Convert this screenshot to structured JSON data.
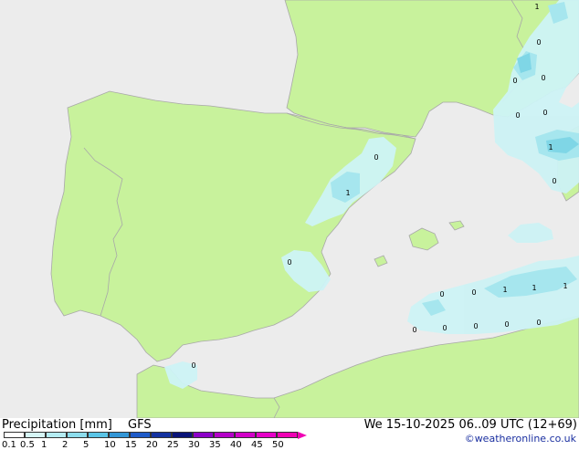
{
  "colors": {
    "sea": "#ececec",
    "land": "#c8f29c",
    "border": "#a8a8a8",
    "precip_light": "#cdf3f5",
    "precip_medium": "#a6e6ee",
    "precip_strong": "#7fd6e6"
  },
  "precip_labels": [
    {
      "id": "ib-0a",
      "text": "0"
    },
    {
      "id": "ib-1",
      "text": "1"
    },
    {
      "id": "ib-0b",
      "text": "0"
    },
    {
      "id": "ib-0c",
      "text": "0"
    },
    {
      "id": "fr-1",
      "text": "1"
    },
    {
      "id": "fr-0a",
      "text": "0"
    },
    {
      "id": "fr-0b",
      "text": "0"
    },
    {
      "id": "fr-0c",
      "text": "0"
    },
    {
      "id": "fr-0d",
      "text": "0"
    },
    {
      "id": "fr-0e",
      "text": "0"
    },
    {
      "id": "it-1",
      "text": "1"
    },
    {
      "id": "it-0a",
      "text": "0"
    },
    {
      "id": "med-0a",
      "text": "0"
    },
    {
      "id": "med-0b",
      "text": "0"
    },
    {
      "id": "med-1a",
      "text": "1"
    },
    {
      "id": "med-1b",
      "text": "1"
    },
    {
      "id": "med-1c",
      "text": "1"
    },
    {
      "id": "med-0c",
      "text": "0"
    },
    {
      "id": "med-0d",
      "text": "0"
    },
    {
      "id": "med-0e",
      "text": "0"
    },
    {
      "id": "med-0f",
      "text": "0"
    },
    {
      "id": "med-0g",
      "text": "0"
    }
  ],
  "footer": {
    "title": "Precipitation [mm]",
    "model": "GFS",
    "datetime": "We 15-10-2025 06..09 UTC (12+69)",
    "credit": "©weatheronline.co.uk"
  },
  "legend": {
    "ticks": [
      "0.1",
      "0.5",
      "1",
      "2",
      "5",
      "10",
      "15",
      "20",
      "25",
      "30",
      "35",
      "40",
      "45",
      "50"
    ],
    "colors": [
      "#ffffff",
      "#d6f6f6",
      "#b4ecf2",
      "#8cdcec",
      "#5ac4e6",
      "#3296d6",
      "#1e5ac8",
      "#1432a0",
      "#0a1478",
      "#8c00c8",
      "#b400c8",
      "#d200c8",
      "#e600c8",
      "#f000b4"
    ]
  }
}
